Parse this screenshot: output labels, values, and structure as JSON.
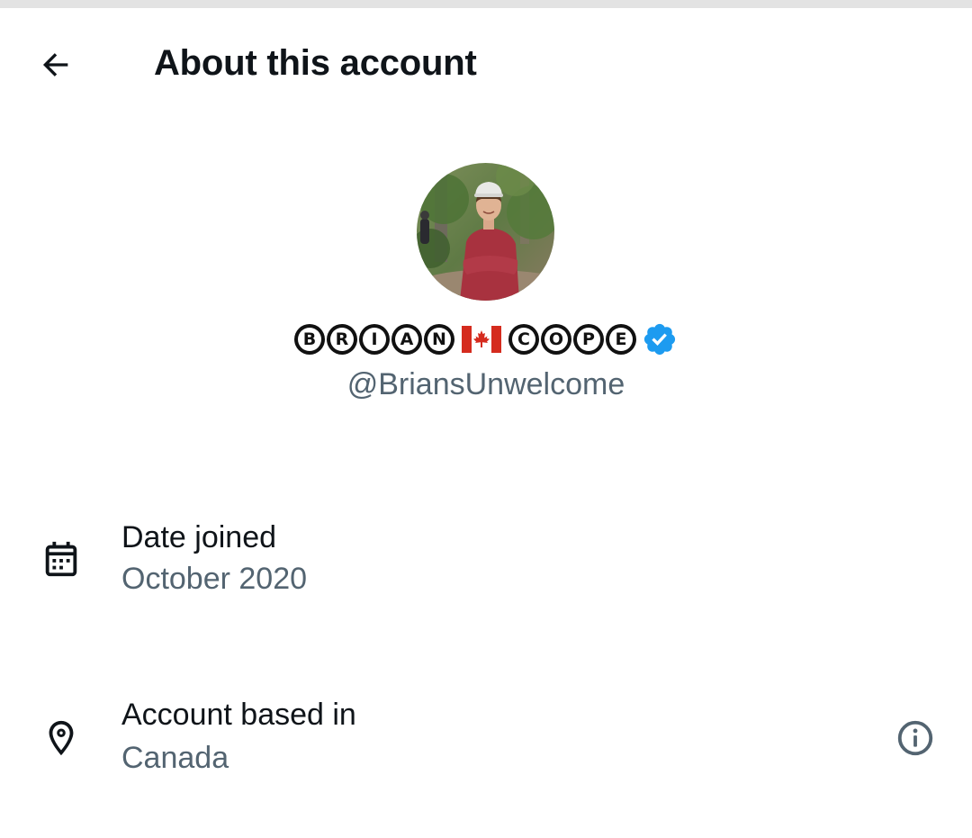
{
  "header": {
    "back_icon": "arrow-left-icon",
    "title": "About this account"
  },
  "profile": {
    "avatar_alt": "profile photo",
    "display_name_letters": {
      "first": [
        "B",
        "R",
        "I",
        "A",
        "N"
      ],
      "flag": "canada-flag",
      "last": [
        "C",
        "O",
        "P",
        "E"
      ]
    },
    "display_name": "BRIAN 🇨🇦 COPE",
    "verified_icon": "verified-badge-icon",
    "verified_color": "#1d9bf0",
    "handle": "@BriansUnwelcome"
  },
  "details": {
    "date_joined": {
      "icon": "calendar-icon",
      "label": "Date joined",
      "value": "October 2020"
    },
    "location": {
      "icon": "location-pin-icon",
      "label": "Account based in",
      "value": "Canada",
      "info_icon": "info-icon"
    }
  },
  "colors": {
    "primary_text": "#0f1419",
    "secondary_text": "#536471",
    "verified": "#1d9bf0",
    "flag_red": "#d52b1e"
  }
}
